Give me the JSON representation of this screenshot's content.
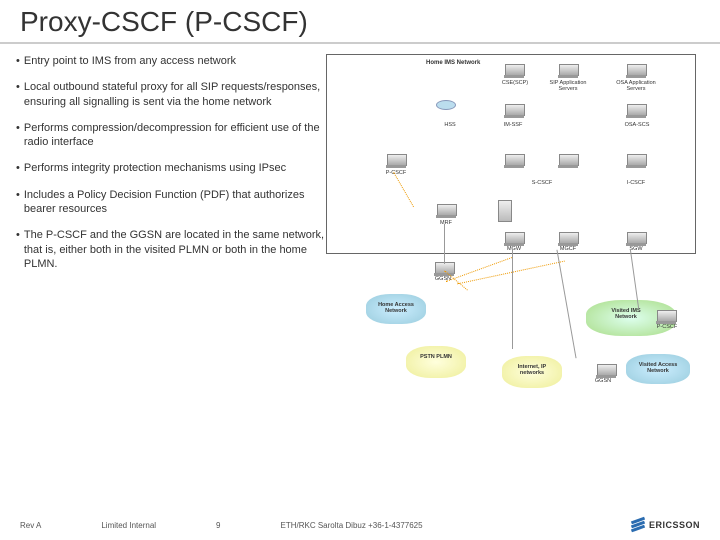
{
  "title": "Proxy-CSCF (P-CSCF)",
  "bullets": [
    "Entry point to IMS from any access network",
    "Local outbound stateful proxy for all SIP requests/responses, ensuring all signalling is sent via the home network",
    "Performs compression/decompression for efficient use of the radio interface",
    "Performs integrity protection mechanisms using IPsec",
    "Includes a Policy Decision Function (PDF) that authorizes bearer resources",
    "The P-CSCF and the GGSN are located in the same network, that is, either both in the visited PLMN or both in the home PLMN."
  ],
  "diagram": {
    "home_ims": "Home IMS Network",
    "cse_scp": "CSE(SCP)",
    "sip_app": "SIP Application Servers",
    "osa_app": "OSA Application Servers",
    "hss": "HSS",
    "imssf": "IM-SSF",
    "osa_scs": "OSA-SCS",
    "pcscf": "P-CSCF",
    "scscf": "S-CSCF",
    "icscf": "I-CSCF",
    "mrf": "MRF",
    "mgw": "MGW",
    "mgcf": "MGCF",
    "sgw": "SGW",
    "ggsn": "GGSN",
    "home_access": "Home Access Network",
    "visited_ims": "Visited IMS Network",
    "pcscf2": "P-CSCF",
    "pstn": "PSTN PLMN",
    "internet": "Internet, IP networks",
    "ggsn2": "GGSN",
    "visited_access": "Visited Access Network"
  },
  "footer": {
    "rev": "Rev A",
    "class": "Limited Internal",
    "page": "9",
    "credit": "ETH/RKC Sarolta Dibuz +36-1-4377625",
    "brand": "ERICSSON"
  }
}
